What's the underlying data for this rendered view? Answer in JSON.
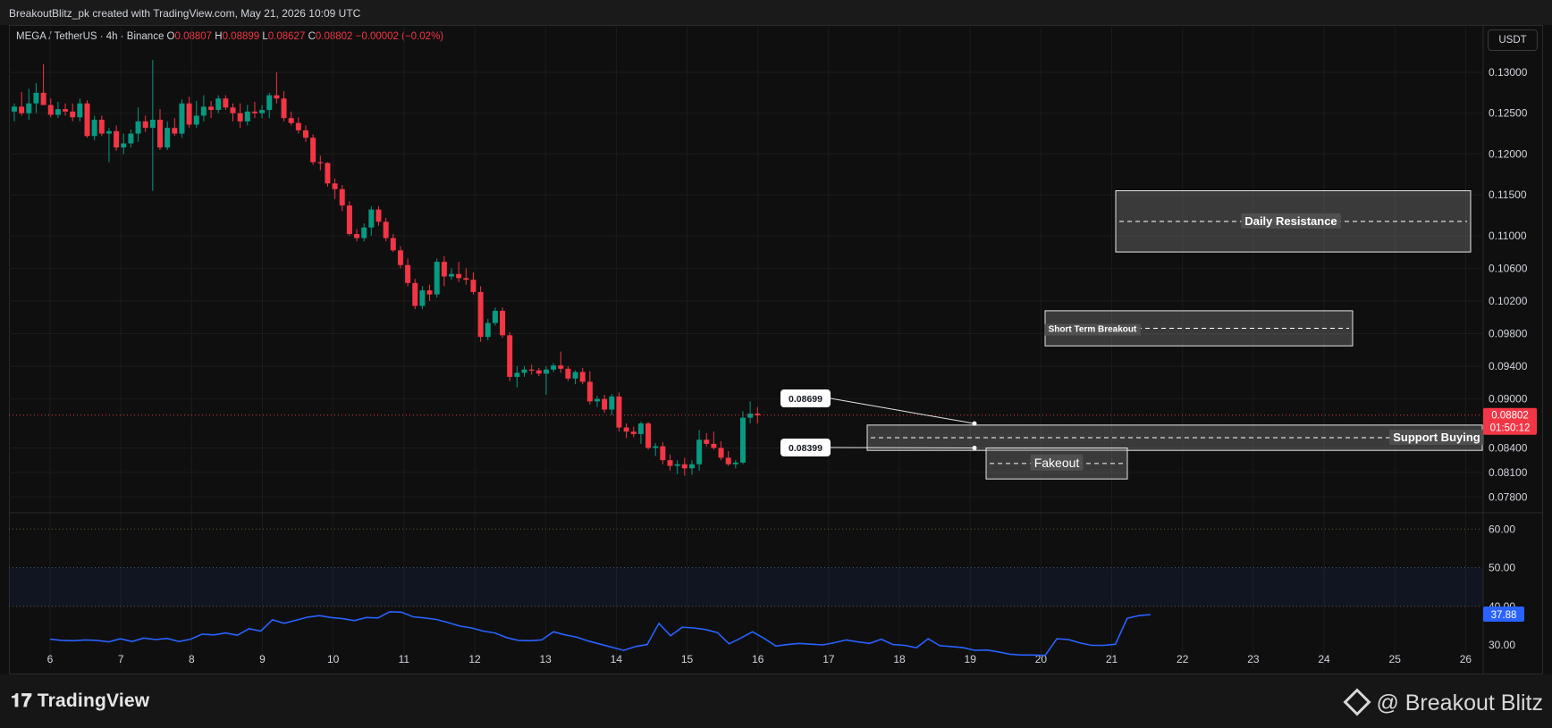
{
  "header": {
    "attribution": "BreakoutBlitz_pk created with TradingView.com, May 21, 2026 10:09 UTC"
  },
  "legend": {
    "symbol": "MEGA / TetherUS · 4h · Binance",
    "open_label": "O",
    "open": "0.08807",
    "high_label": "H",
    "high": "0.08899",
    "low_label": "L",
    "low": "0.08627",
    "close_label": "C",
    "close": "0.08802",
    "change": "−0.00002 (−0.02%)"
  },
  "currency_button": "USDT",
  "footer": {
    "logo": "TradingView",
    "brand": "@ Breakout Blitz"
  },
  "colors": {
    "up": "#089981",
    "down": "#f23645",
    "rsi": "#2962ff",
    "background": "#0f0f0f"
  },
  "chart_data": [
    {
      "type": "candlestick",
      "title": "",
      "x_ticks": [
        "6",
        "7",
        "8",
        "9",
        "10",
        "11",
        "12",
        "13",
        "14",
        "15",
        "16",
        "17",
        "18",
        "19",
        "20",
        "21",
        "22",
        "23",
        "24",
        "25",
        "26"
      ],
      "y_ticks": [
        "0.13000",
        "0.12500",
        "0.12000",
        "0.11500",
        "0.11000",
        "0.10600",
        "0.10200",
        "0.09800",
        "0.09400",
        "0.09000",
        "0.08400",
        "0.08100",
        "0.07800"
      ],
      "ylim": [
        0.0765,
        0.1323
      ],
      "last_price": "0.08802",
      "countdown": "01:50:12",
      "candles": [
        [
          0.1252,
          0.1262,
          0.124,
          0.1258
        ],
        [
          0.1258,
          0.1276,
          0.1247,
          0.125
        ],
        [
          0.125,
          0.128,
          0.1242,
          0.1262
        ],
        [
          0.1262,
          0.1287,
          0.125,
          0.1275
        ],
        [
          0.1275,
          0.131,
          0.1262,
          0.126
        ],
        [
          0.126,
          0.1268,
          0.1245,
          0.1248
        ],
        [
          0.1248,
          0.1264,
          0.1244,
          0.1255
        ],
        [
          0.1255,
          0.1262,
          0.1247,
          0.1252
        ],
        [
          0.1252,
          0.1262,
          0.124,
          0.1245
        ],
        [
          0.1245,
          0.1268,
          0.124,
          0.1262
        ],
        [
          0.1262,
          0.1266,
          0.122,
          0.1222
        ],
        [
          0.1222,
          0.1247,
          0.1217,
          0.1242
        ],
        [
          0.1242,
          0.1247,
          0.1222,
          0.1225
        ],
        [
          0.1225,
          0.1232,
          0.119,
          0.1228
        ],
        [
          0.1228,
          0.1235,
          0.1204,
          0.1208
        ],
        [
          0.1208,
          0.1225,
          0.12,
          0.1213
        ],
        [
          0.1213,
          0.123,
          0.1208,
          0.1225
        ],
        [
          0.1225,
          0.1257,
          0.1215,
          0.124
        ],
        [
          0.124,
          0.1247,
          0.1227,
          0.1232
        ],
        [
          0.1232,
          0.1315,
          0.1155,
          0.1242
        ],
        [
          0.1242,
          0.1255,
          0.1205,
          0.1208
        ],
        [
          0.1208,
          0.124,
          0.1205,
          0.1232
        ],
        [
          0.1232,
          0.1244,
          0.1222,
          0.1225
        ],
        [
          0.1225,
          0.1267,
          0.122,
          0.1262
        ],
        [
          0.1262,
          0.127,
          0.1232,
          0.1236
        ],
        [
          0.1236,
          0.1265,
          0.1232,
          0.1247
        ],
        [
          0.1247,
          0.1272,
          0.124,
          0.1258
        ],
        [
          0.1258,
          0.1265,
          0.1244,
          0.1254
        ],
        [
          0.1254,
          0.1272,
          0.125,
          0.1268
        ],
        [
          0.1268,
          0.1272,
          0.1254,
          0.1257
        ],
        [
          0.1257,
          0.1262,
          0.124,
          0.125
        ],
        [
          0.125,
          0.1262,
          0.1232,
          0.124
        ],
        [
          0.124,
          0.126,
          0.1235,
          0.1252
        ],
        [
          0.1252,
          0.1264,
          0.1244,
          0.125
        ],
        [
          0.125,
          0.126,
          0.1244,
          0.1254
        ],
        [
          0.1254,
          0.1275,
          0.1244,
          0.1272
        ],
        [
          0.1272,
          0.13,
          0.1262,
          0.1268
        ],
        [
          0.1268,
          0.1277,
          0.124,
          0.1244
        ],
        [
          0.1244,
          0.1252,
          0.1235,
          0.1238
        ],
        [
          0.1238,
          0.1245,
          0.1225,
          0.1229
        ],
        [
          0.1229,
          0.1235,
          0.1215,
          0.122
        ],
        [
          0.122,
          0.1224,
          0.1187,
          0.119
        ],
        [
          0.119,
          0.1198,
          0.118,
          0.1189
        ],
        [
          0.1189,
          0.119,
          0.116,
          0.1164
        ],
        [
          0.1164,
          0.117,
          0.1145,
          0.1157
        ],
        [
          0.1157,
          0.1162,
          0.113,
          0.1137
        ],
        [
          0.1137,
          0.1142,
          0.11,
          0.1102
        ],
        [
          0.1102,
          0.1108,
          0.1093,
          0.1097
        ],
        [
          0.1097,
          0.1115,
          0.1093,
          0.111
        ],
        [
          0.111,
          0.1136,
          0.11,
          0.1132
        ],
        [
          0.1132,
          0.1136,
          0.1112,
          0.1117
        ],
        [
          0.1117,
          0.1122,
          0.1093,
          0.1097
        ],
        [
          0.1097,
          0.1102,
          0.108,
          0.1082
        ],
        [
          0.1082,
          0.1087,
          0.106,
          0.1064
        ],
        [
          0.1064,
          0.1072,
          0.1038,
          0.1042
        ],
        [
          0.1042,
          0.1047,
          0.101,
          0.1014
        ],
        [
          0.1014,
          0.1038,
          0.101,
          0.1033
        ],
        [
          0.1033,
          0.104,
          0.102,
          0.1028
        ],
        [
          0.1028,
          0.1072,
          0.1024,
          0.1068
        ],
        [
          0.1068,
          0.1075,
          0.1038,
          0.105
        ],
        [
          0.105,
          0.106,
          0.1046,
          0.1053
        ],
        [
          0.1053,
          0.1068,
          0.1043,
          0.1048
        ],
        [
          0.1048,
          0.106,
          0.104,
          0.1046
        ],
        [
          0.1046,
          0.1055,
          0.1028,
          0.1031
        ],
        [
          0.1031,
          0.1038,
          0.097,
          0.0976
        ],
        [
          0.0976,
          0.0998,
          0.0972,
          0.0993
        ],
        [
          0.0993,
          0.1012,
          0.099,
          0.1008
        ],
        [
          0.1008,
          0.1012,
          0.0975,
          0.0978
        ],
        [
          0.0978,
          0.0982,
          0.0922,
          0.0927
        ],
        [
          0.0927,
          0.094,
          0.0914,
          0.0932
        ],
        [
          0.0932,
          0.094,
          0.0927,
          0.0936
        ],
        [
          0.0936,
          0.0942,
          0.093,
          0.0935
        ],
        [
          0.0935,
          0.0938,
          0.0928,
          0.0931
        ],
        [
          0.0931,
          0.094,
          0.0905,
          0.0936
        ],
        [
          0.0936,
          0.0944,
          0.0933,
          0.0941
        ],
        [
          0.0941,
          0.0958,
          0.0932,
          0.0937
        ],
        [
          0.0937,
          0.094,
          0.0922,
          0.0925
        ],
        [
          0.0925,
          0.0935,
          0.0918,
          0.0933
        ],
        [
          0.0933,
          0.0938,
          0.0918,
          0.0921
        ],
        [
          0.0921,
          0.0934,
          0.0893,
          0.0897
        ],
        [
          0.0897,
          0.0904,
          0.089,
          0.09
        ],
        [
          0.09,
          0.0905,
          0.0883,
          0.0887
        ],
        [
          0.0887,
          0.0906,
          0.088,
          0.0903
        ],
        [
          0.0903,
          0.0908,
          0.086,
          0.0865
        ],
        [
          0.0865,
          0.087,
          0.0852,
          0.086
        ],
        [
          0.086,
          0.0866,
          0.0853,
          0.0857
        ],
        [
          0.0857,
          0.0872,
          0.0845,
          0.087
        ],
        [
          0.087,
          0.0872,
          0.0838,
          0.084
        ],
        [
          0.084,
          0.0846,
          0.083,
          0.0842
        ],
        [
          0.0842,
          0.0847,
          0.082,
          0.0825
        ],
        [
          0.0825,
          0.0832,
          0.0812,
          0.0818
        ],
        [
          0.0818,
          0.0825,
          0.0808,
          0.082
        ],
        [
          0.082,
          0.0828,
          0.0806,
          0.0815
        ],
        [
          0.0815,
          0.0825,
          0.0807,
          0.082
        ],
        [
          0.082,
          0.0862,
          0.0812,
          0.085
        ],
        [
          0.085,
          0.0858,
          0.0842,
          0.0845
        ],
        [
          0.0845,
          0.086,
          0.0838,
          0.084
        ],
        [
          0.084,
          0.0848,
          0.0825,
          0.0828
        ],
        [
          0.0828,
          0.0836,
          0.0818,
          0.082
        ],
        [
          0.082,
          0.0825,
          0.0815,
          0.0822
        ],
        [
          0.0822,
          0.0885,
          0.082,
          0.0877
        ],
        [
          0.0877,
          0.0897,
          0.087,
          0.0882
        ],
        [
          0.0882,
          0.089,
          0.087,
          0.088
        ]
      ],
      "annotations": {
        "daily_resistance": "Daily Resistance",
        "short_term_breakout": "Short Term Breakout",
        "support_buying": "Support Buying",
        "fakeout": "Fakeout",
        "label_high": "0.08699",
        "label_low": "0.08399"
      }
    },
    {
      "type": "line",
      "title": "",
      "y_ticks": [
        "60.00",
        "50.00",
        "40.00",
        "30.00"
      ],
      "ylim": [
        24,
        64
      ],
      "last_value": "37.88",
      "series": [
        {
          "values": [
            31.5,
            31.2,
            31.1,
            31.3,
            31.2,
            30.8,
            31.6,
            30.9,
            31.8,
            31.4,
            31.7,
            30.9,
            31.5,
            32.8,
            32.6,
            33.1,
            32.5,
            34.2,
            33.6,
            36.5,
            35.6,
            36.4,
            37.2,
            37.6,
            37.1,
            36.8,
            36.3,
            37.1,
            37.0,
            38.6,
            38.5,
            37.3,
            37.0,
            36.6,
            35.8,
            34.9,
            34.4,
            33.6,
            33.1,
            31.9,
            31.2,
            31.1,
            31.3,
            33.4,
            32.6,
            32.0,
            31.0,
            30.2,
            29.4,
            28.6,
            29.6,
            30.1,
            35.6,
            32.4,
            34.6,
            34.4,
            34.0,
            33.2,
            30.3,
            31.8,
            33.4,
            31.7,
            29.7,
            30.1,
            30.4,
            30.2,
            30.0,
            30.6,
            31.3,
            30.8,
            30.4,
            31.5,
            30.1,
            29.9,
            29.3,
            31.6,
            29.8,
            29.6,
            29.3,
            28.6,
            28.7,
            28.2,
            27.6,
            27.4,
            27.4,
            27.3,
            31.6,
            31.4,
            30.5,
            29.9,
            29.9,
            30.2,
            36.9,
            37.6,
            37.88
          ]
        }
      ]
    }
  ]
}
